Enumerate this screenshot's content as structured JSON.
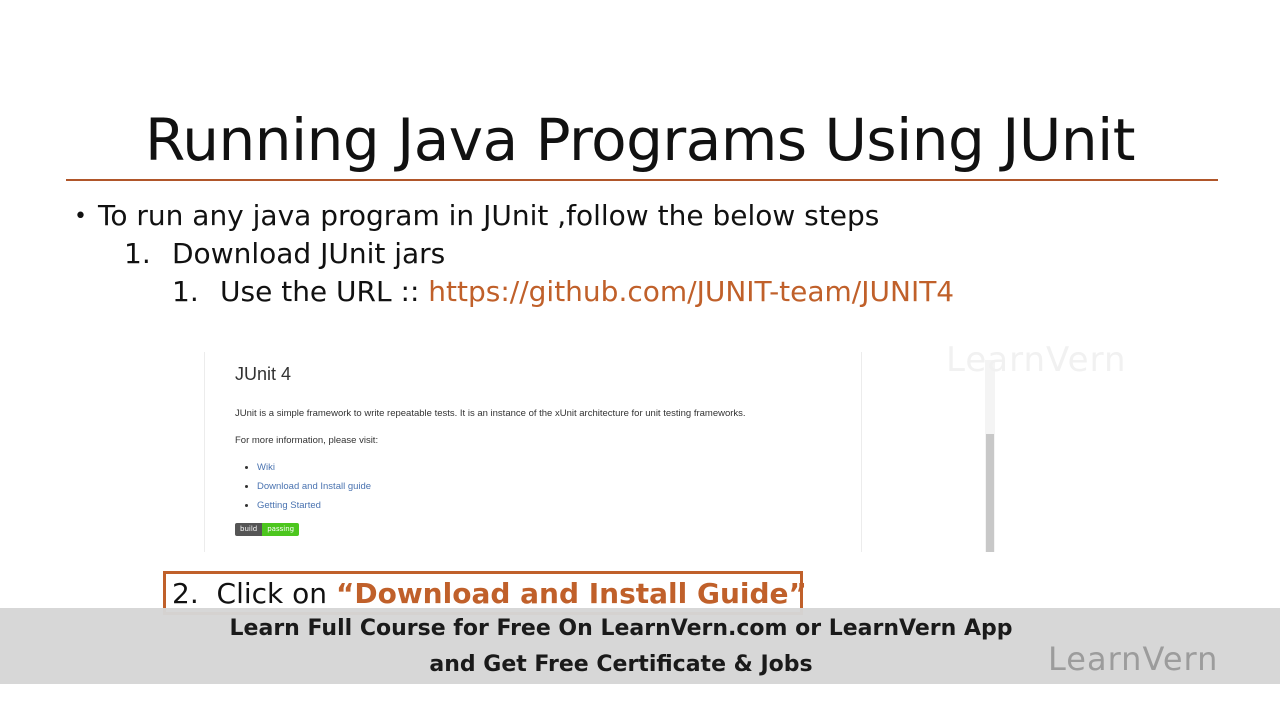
{
  "slide": {
    "title": "Running Java Programs Using JUnit",
    "bullet": "To run any java program in JUnit ,follow the below steps",
    "bullet_marker": "•",
    "step1": {
      "number": "1.",
      "text": "Download JUnit jars"
    },
    "substep1": {
      "number": "1.",
      "text": "Use the URL :: ",
      "url": "https://github.com/JUNIT-team/JUNIT4"
    },
    "step2": {
      "number": "2.",
      "text": "Click on ",
      "quoted": "“Download and Install Guide”"
    }
  },
  "embed": {
    "title": "JUnit 4",
    "description": "JUnit is a simple framework to write repeatable tests. It is an instance of the xUnit architecture for unit testing frameworks.",
    "more_info": "For more information, please visit:",
    "links": [
      "Wiki",
      "Download and Install guide",
      "Getting Started"
    ],
    "badge": {
      "left": "build",
      "right": "passing"
    }
  },
  "watermark": "LearnVern",
  "banner": {
    "line1": "Learn Full Course for Free On LearnVern.com or LearnVern App",
    "line2": "and Get Free Certificate & Jobs",
    "brand": "LearnVern"
  },
  "colors": {
    "accent": "#c0602a",
    "rule": "#b0562a",
    "banner_bg": "#d6d6d6",
    "badge_pass": "#4cc61e"
  }
}
